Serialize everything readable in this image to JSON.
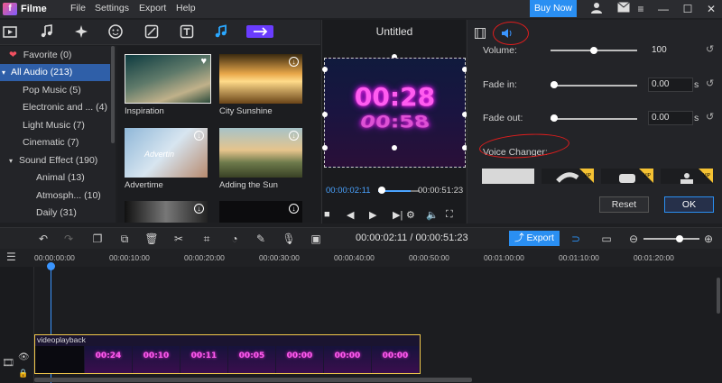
{
  "app": {
    "name": "Filme",
    "menu": [
      "File",
      "Settings",
      "Export",
      "Help"
    ],
    "buy_now": "Buy Now"
  },
  "library": {
    "categories": [
      {
        "label": "Favorite (0)",
        "icon": "heart-icon"
      },
      {
        "label": "All Audio (213)",
        "selected": true
      },
      {
        "label": "Pop Music (5)"
      },
      {
        "label": "Electronic and ... (4)"
      },
      {
        "label": "Light Music (7)"
      },
      {
        "label": "Cinematic (7)"
      },
      {
        "label": "Sound Effect (190)"
      },
      {
        "label": "Animal (13)"
      },
      {
        "label": "Atmosph... (10)"
      },
      {
        "label": "Daily (31)"
      }
    ],
    "items": [
      {
        "label": "Inspiration",
        "icon": "heart-icon"
      },
      {
        "label": "City Sunshine",
        "icon": "download-icon"
      },
      {
        "label": "Advertime",
        "icon": "download-icon",
        "overlay_text": "Advertin"
      },
      {
        "label": "Adding the Sun",
        "icon": "download-icon"
      },
      {
        "label": "",
        "icon": "download-icon"
      },
      {
        "label": "",
        "icon": "download-icon"
      }
    ]
  },
  "preview": {
    "title": "Untitled",
    "neon_line1": "00:28",
    "neon_line2": "00:58",
    "current_time": "00:00:02:11",
    "total_time": "00:00:51:23"
  },
  "audio_panel": {
    "volume_label": "Volume:",
    "volume_value": "100",
    "volume_fraction": 0.5,
    "fade_in_label": "Fade in:",
    "fade_in_value": "0.00",
    "fade_in_fraction": 0.0,
    "fade_out_label": "Fade out:",
    "fade_out_value": "0.00",
    "fade_out_fraction": 0.0,
    "unit": "s",
    "voice_changer_label": "Voice Changer:",
    "reset": "Reset",
    "ok": "OK",
    "vip_badge": "VIP"
  },
  "toolbar": {
    "timecode": "00:00:02:11 / 00:00:51:23",
    "export": "Export"
  },
  "timeline": {
    "ticks": [
      "00:00:00:00",
      "00:00:10:00",
      "00:00:20:00",
      "00:00:30:00",
      "00:00:40:00",
      "00:00:50:00",
      "00:01:00:00",
      "00:01:10:00",
      "00:01:20:00"
    ],
    "clip_name": "videoplayback",
    "clip_frames": [
      "00:24",
      "00:10",
      "00:11",
      "00:05",
      "00:00",
      "00:00",
      "00:00"
    ]
  },
  "colors": {
    "accent": "#2a8ff2",
    "selection": "#2f5fa8",
    "annotation": "#e01d1d",
    "clip_border": "#f2c84b"
  }
}
